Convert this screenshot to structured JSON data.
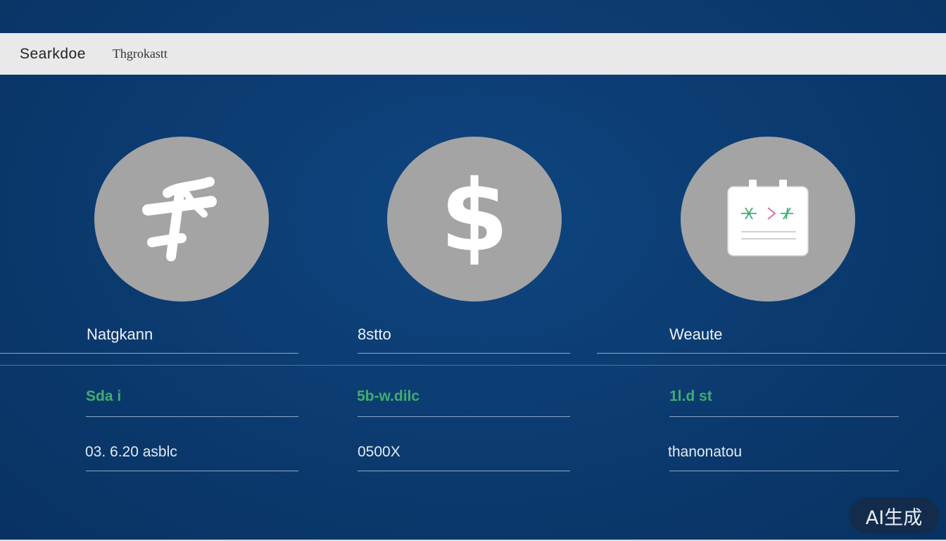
{
  "header": {
    "brand": "Searkdoe",
    "nav_item": "Thgrokastt"
  },
  "cards": [
    {
      "icon": "hash-scribble-icon",
      "label": "Natgkann",
      "green_text": "Sda i",
      "value": "03. 6.20 asblc"
    },
    {
      "icon": "dollar-icon",
      "symbol": "$",
      "label": "8stto",
      "green_text": "5b-w.dilc",
      "value": "0500X"
    },
    {
      "icon": "calendar-icon",
      "label": "Weaute",
      "green_text": "1l.d st",
      "value": "thanonatou"
    }
  ],
  "watermark": "AI生成",
  "colors": {
    "background": "#0b3a6f",
    "topbar": "#e9e9e9",
    "circle": "#a4a4a4",
    "accent_green": "#3fae6f"
  }
}
